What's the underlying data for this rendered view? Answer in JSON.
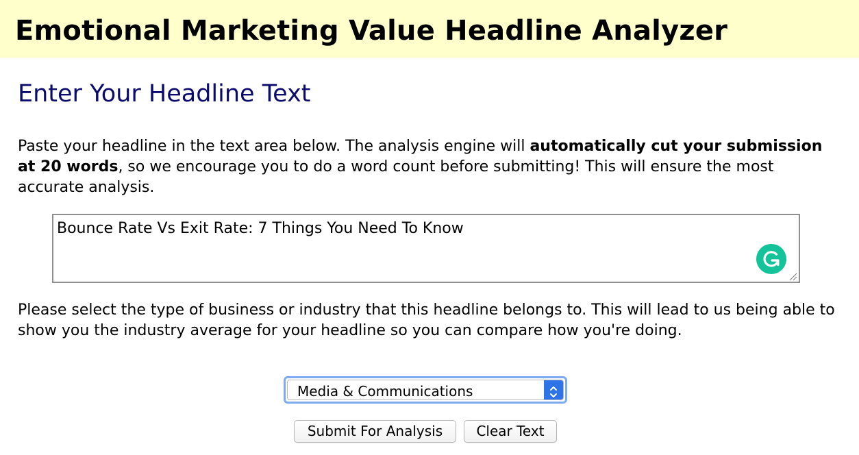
{
  "header": {
    "title": "Emotional Marketing Value Headline Analyzer"
  },
  "section": {
    "subtitle": "Enter Your Headline Text"
  },
  "intro": {
    "text_1": "Paste your headline in the text area below. The analysis engine will ",
    "bold": "automatically cut your submission at 20 words",
    "text_2": ", so we encourage you to do a word count before submitting! This will ensure the most accurate analysis."
  },
  "headline_input": {
    "value": "Bounce Rate Vs Exit Rate: 7 Things You Need To Know",
    "grammarly_icon": "grammarly-g-icon"
  },
  "industry": {
    "prompt": "Please select the type of business or industry that this headline belongs to. This will lead to us being able to show you the industry average for your headline so you can compare how you're doing.",
    "selected": "Media & Communications"
  },
  "actions": {
    "submit_label": "Submit For Analysis",
    "clear_label": "Clear Text"
  },
  "colors": {
    "banner_bg": "#ffffcc",
    "subtitle": "#0b0b6e",
    "grammarly": "#15c39a",
    "select_focus": "#7eaaf2",
    "select_arrow_bg": "#2f73e8"
  }
}
